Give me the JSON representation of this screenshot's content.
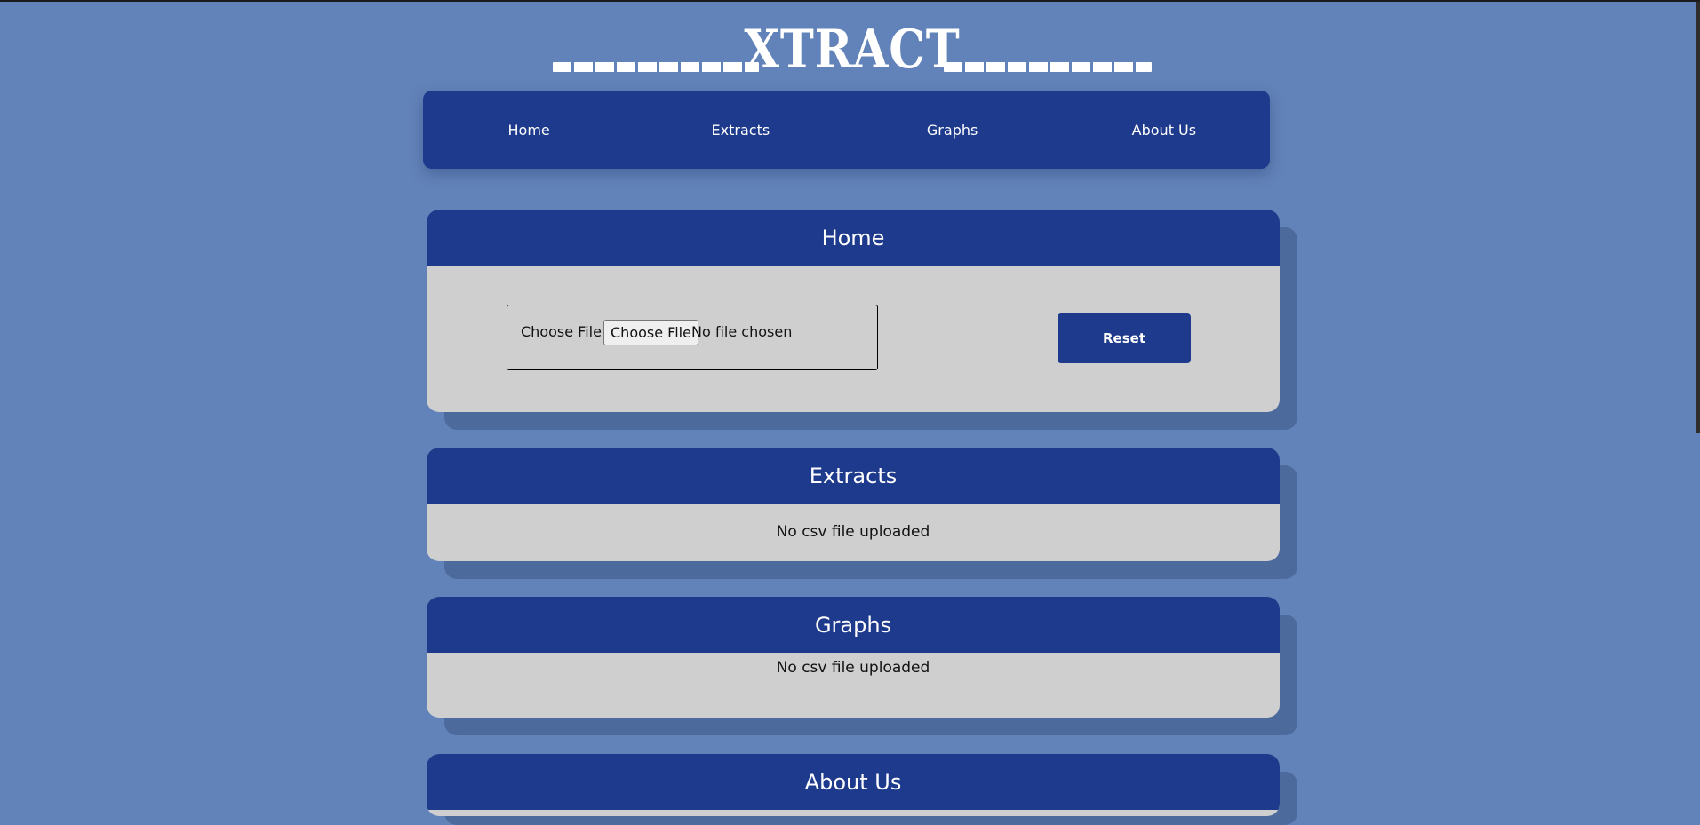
{
  "header": {
    "logo_text": "XTRACT"
  },
  "nav": {
    "items": [
      "Home",
      "Extracts",
      "Graphs",
      "About Us"
    ]
  },
  "home": {
    "title": "Home",
    "file_label": "Choose File :",
    "file_button_label": "Choose File",
    "file_status": "No file chosen",
    "reset_label": "Reset"
  },
  "extracts": {
    "title": "Extracts",
    "message": "No csv file uploaded"
  },
  "graphs": {
    "title": "Graphs",
    "message": "No csv file uploaded"
  },
  "about": {
    "title": "About Us"
  },
  "colors": {
    "background": "#6283b9",
    "primary": "#1e3a8c",
    "card_body": "#cfcfcf",
    "text_on_primary": "#ffffff"
  }
}
